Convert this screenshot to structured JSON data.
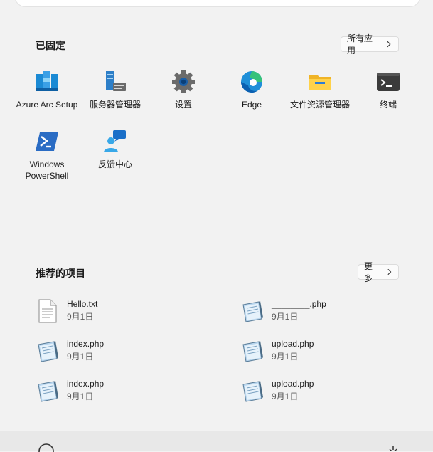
{
  "pinned": {
    "title": "已固定",
    "all_apps_label": "所有应用",
    "apps": [
      {
        "label": "Azure Arc Setup",
        "icon": "azure-arc-icon"
      },
      {
        "label": "服务器管理器",
        "icon": "server-manager-icon"
      },
      {
        "label": "设置",
        "icon": "settings-gear-icon"
      },
      {
        "label": "Edge",
        "icon": "edge-icon"
      },
      {
        "label": "文件资源管理器",
        "icon": "file-explorer-icon"
      },
      {
        "label": "终端",
        "icon": "terminal-icon"
      },
      {
        "label": "Windows\nPowerShell",
        "icon": "powershell-icon"
      },
      {
        "label": "反馈中心",
        "icon": "feedback-hub-icon"
      }
    ]
  },
  "recommended": {
    "title": "推荐的项目",
    "more_label": "更多",
    "items": [
      {
        "name": "Hello.txt",
        "date": "9月1日",
        "icon": "text-file-icon"
      },
      {
        "name": "________.php",
        "date": "9月1日",
        "icon": "php-file-icon"
      },
      {
        "name": "index.php",
        "date": "9月1日",
        "icon": "php-file-icon"
      },
      {
        "name": "upload.php",
        "date": "9月1日",
        "icon": "php-file-icon"
      },
      {
        "name": "index.php",
        "date": "9月1日",
        "icon": "php-file-icon"
      },
      {
        "name": "upload.php",
        "date": "9月1日",
        "icon": "php-file-icon"
      }
    ]
  },
  "colors": {
    "background": "#f2f2f2",
    "accent": "#0067c0"
  }
}
